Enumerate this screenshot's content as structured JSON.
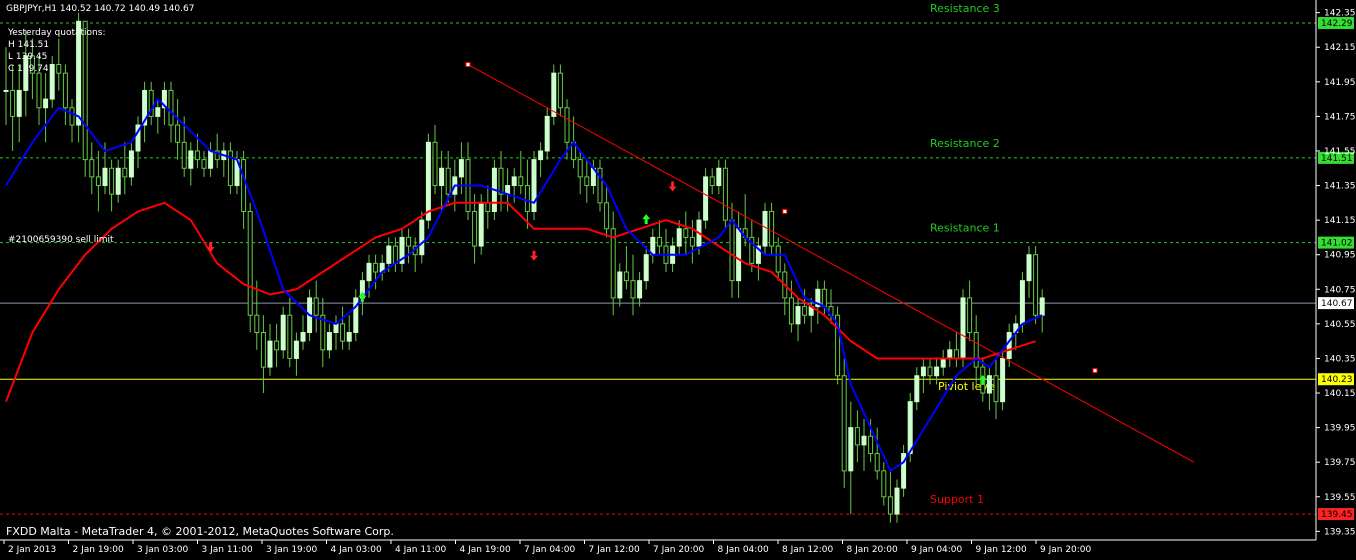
{
  "window": {
    "header": "GBPJPYr,H1  140.52 140.72 140.49 140.67",
    "footer": "FXDD Malta - MetaTrader 4, © 2001-2012, MetaQuotes Software Corp."
  },
  "quotes": {
    "title": "Yesterday quotations:",
    "high": "H 141.51",
    "low": "L 139.45",
    "close": "C 139.74"
  },
  "order": {
    "label": "#2100659390 sell limit"
  },
  "colors": {
    "background": "#000000",
    "bull": "#ccffcc",
    "bear": "#66cc44",
    "fast_ma": "#0000ff",
    "slow_ma": "#ff0000",
    "trendline": "#ff0000",
    "resistance": "#22cc22",
    "pivot": "#ffff00",
    "support": "#ff0000"
  },
  "chart_data": {
    "type": "candlestick",
    "symbol": "GBPJPYr",
    "timeframe": "H1",
    "ylim": [
      139.3,
      142.4
    ],
    "price_ticks": [
      "142.35",
      "142.15",
      "141.95",
      "141.75",
      "141.55",
      "141.35",
      "141.15",
      "140.95",
      "140.75",
      "140.55",
      "140.35",
      "140.15",
      "139.95",
      "139.75",
      "139.55",
      "139.35"
    ],
    "time_labels": [
      "2 Jan 2013",
      "2 Jan 19:00",
      "3 Jan 03:00",
      "3 Jan 11:00",
      "3 Jan 19:00",
      "4 Jan 03:00",
      "4 Jan 11:00",
      "4 Jan 19:00",
      "7 Jan 04:00",
      "7 Jan 12:00",
      "7 Jan 20:00",
      "8 Jan 04:00",
      "8 Jan 12:00",
      "8 Jan 20:00",
      "9 Jan 04:00",
      "9 Jan 12:00",
      "9 Jan 20:00"
    ],
    "levels": [
      {
        "name": "Resistance 3",
        "price": 142.29,
        "label": "142.29",
        "style": "resistance"
      },
      {
        "name": "Resistance 2",
        "price": 141.51,
        "label": "141.51",
        "style": "resistance"
      },
      {
        "name": "Resistance 1",
        "price": 141.02,
        "label": "141.02",
        "style": "resistance"
      },
      {
        "name": "Piviot level",
        "price": 140.23,
        "label": "140.23",
        "style": "pivot"
      },
      {
        "name": "Support 1",
        "price": 139.45,
        "label": "139.45",
        "style": "support"
      }
    ],
    "current_price": {
      "value": 140.67,
      "label": "140.67"
    },
    "ohlc": [
      [
        141.9,
        142.15,
        141.7,
        141.9
      ],
      [
        141.9,
        142.05,
        141.55,
        141.75
      ],
      [
        141.75,
        142.05,
        141.6,
        141.9
      ],
      [
        141.9,
        142.25,
        141.75,
        142.1
      ],
      [
        142.1,
        142.2,
        141.85,
        142.0
      ],
      [
        142.0,
        142.1,
        141.7,
        141.8
      ],
      [
        141.8,
        142.0,
        141.6,
        141.85
      ],
      [
        141.85,
        142.1,
        141.8,
        142.05
      ],
      [
        142.05,
        142.2,
        141.9,
        142.0
      ],
      [
        142.0,
        142.05,
        141.7,
        141.8
      ],
      [
        141.8,
        141.85,
        141.6,
        141.7
      ],
      [
        141.7,
        142.35,
        141.6,
        142.3
      ],
      [
        142.3,
        142.3,
        141.4,
        141.5
      ],
      [
        141.5,
        141.6,
        141.3,
        141.4
      ],
      [
        141.4,
        141.55,
        141.2,
        141.35
      ],
      [
        141.35,
        141.6,
        141.3,
        141.45
      ],
      [
        141.45,
        141.5,
        141.2,
        141.3
      ],
      [
        141.3,
        141.5,
        141.25,
        141.45
      ],
      [
        141.45,
        141.6,
        141.3,
        141.4
      ],
      [
        141.4,
        141.6,
        141.35,
        141.55
      ],
      [
        141.55,
        141.75,
        141.45,
        141.7
      ],
      [
        141.7,
        141.95,
        141.6,
        141.9
      ],
      [
        141.9,
        141.95,
        141.7,
        141.75
      ],
      [
        141.75,
        141.85,
        141.65,
        141.8
      ],
      [
        141.8,
        141.95,
        141.7,
        141.9
      ],
      [
        141.9,
        141.95,
        141.6,
        141.7
      ],
      [
        141.7,
        141.85,
        141.5,
        141.6
      ],
      [
        141.6,
        141.75,
        141.4,
        141.45
      ],
      [
        141.45,
        141.6,
        141.35,
        141.55
      ],
      [
        141.55,
        141.65,
        141.45,
        141.5
      ],
      [
        141.5,
        141.55,
        141.4,
        141.45
      ],
      [
        141.45,
        141.6,
        141.4,
        141.55
      ],
      [
        141.55,
        141.65,
        141.45,
        141.5
      ],
      [
        141.5,
        141.6,
        141.4,
        141.55
      ],
      [
        141.55,
        141.6,
        141.3,
        141.35
      ],
      [
        141.35,
        141.55,
        141.3,
        141.5
      ],
      [
        141.5,
        141.55,
        141.1,
        141.2
      ],
      [
        141.2,
        141.25,
        140.5,
        140.6
      ],
      [
        140.6,
        140.8,
        140.4,
        140.5
      ],
      [
        140.5,
        140.6,
        140.15,
        140.3
      ],
      [
        140.3,
        140.55,
        140.25,
        140.45
      ],
      [
        140.45,
        140.55,
        140.3,
        140.4
      ],
      [
        140.4,
        140.65,
        140.35,
        140.6
      ],
      [
        140.6,
        140.7,
        140.3,
        140.35
      ],
      [
        140.35,
        140.5,
        140.25,
        140.45
      ],
      [
        140.45,
        140.6,
        140.4,
        140.5
      ],
      [
        140.5,
        140.75,
        140.45,
        140.7
      ],
      [
        140.7,
        140.8,
        140.5,
        140.6
      ],
      [
        140.6,
        140.7,
        140.3,
        140.4
      ],
      [
        140.4,
        140.55,
        140.35,
        140.5
      ],
      [
        140.5,
        140.6,
        140.4,
        140.55
      ],
      [
        140.55,
        140.65,
        140.4,
        140.45
      ],
      [
        140.45,
        140.6,
        140.4,
        140.5
      ],
      [
        140.5,
        140.75,
        140.45,
        140.7
      ],
      [
        140.7,
        140.85,
        140.6,
        140.8
      ],
      [
        140.8,
        140.95,
        140.7,
        140.9
      ],
      [
        140.9,
        140.95,
        140.75,
        140.85
      ],
      [
        140.85,
        140.95,
        140.8,
        140.9
      ],
      [
        140.9,
        141.05,
        140.85,
        141.0
      ],
      [
        141.0,
        141.05,
        140.85,
        140.9
      ],
      [
        140.9,
        141.1,
        140.85,
        141.05
      ],
      [
        141.05,
        141.1,
        140.9,
        141.0
      ],
      [
        141.0,
        141.05,
        140.85,
        140.95
      ],
      [
        140.95,
        141.2,
        140.9,
        141.15
      ],
      [
        141.15,
        141.65,
        141.1,
        141.6
      ],
      [
        141.6,
        141.7,
        141.3,
        141.35
      ],
      [
        141.35,
        141.55,
        141.2,
        141.45
      ],
      [
        141.45,
        141.55,
        141.25,
        141.3
      ],
      [
        141.3,
        141.5,
        141.2,
        141.4
      ],
      [
        141.4,
        141.6,
        141.3,
        141.5
      ],
      [
        141.5,
        141.6,
        141.15,
        141.2
      ],
      [
        141.2,
        141.3,
        140.9,
        141.0
      ],
      [
        141.0,
        141.3,
        140.95,
        141.25
      ],
      [
        141.25,
        141.35,
        141.1,
        141.2
      ],
      [
        141.2,
        141.5,
        141.15,
        141.45
      ],
      [
        141.45,
        141.55,
        141.2,
        141.3
      ],
      [
        141.3,
        141.45,
        141.2,
        141.35
      ],
      [
        141.35,
        141.45,
        141.25,
        141.4
      ],
      [
        141.4,
        141.55,
        141.3,
        141.35
      ],
      [
        141.35,
        141.5,
        141.1,
        141.2
      ],
      [
        141.2,
        141.55,
        141.15,
        141.5
      ],
      [
        141.5,
        141.6,
        141.4,
        141.55
      ],
      [
        141.55,
        141.8,
        141.5,
        141.75
      ],
      [
        141.75,
        142.05,
        141.7,
        142.0
      ],
      [
        142.0,
        142.05,
        141.75,
        141.8
      ],
      [
        141.8,
        141.85,
        141.5,
        141.6
      ],
      [
        141.6,
        141.75,
        141.45,
        141.5
      ],
      [
        141.5,
        141.55,
        141.3,
        141.4
      ],
      [
        141.4,
        141.5,
        141.25,
        141.35
      ],
      [
        141.35,
        141.5,
        141.3,
        141.45
      ],
      [
        141.45,
        141.5,
        141.2,
        141.25
      ],
      [
        141.25,
        141.35,
        141.05,
        141.1
      ],
      [
        141.1,
        141.2,
        140.6,
        140.7
      ],
      [
        140.7,
        140.9,
        140.65,
        140.85
      ],
      [
        140.85,
        141.0,
        140.75,
        140.8
      ],
      [
        140.8,
        140.95,
        140.6,
        140.7
      ],
      [
        140.7,
        140.85,
        140.65,
        140.8
      ],
      [
        140.8,
        141.0,
        140.75,
        140.95
      ],
      [
        140.95,
        141.1,
        140.9,
        141.05
      ],
      [
        141.05,
        141.15,
        140.95,
        141.0
      ],
      [
        141.0,
        141.1,
        140.85,
        140.9
      ],
      [
        140.9,
        141.05,
        140.85,
        141.0
      ],
      [
        141.0,
        141.15,
        140.95,
        141.1
      ],
      [
        141.1,
        141.2,
        140.95,
        141.05
      ],
      [
        141.05,
        141.15,
        140.9,
        141.0
      ],
      [
        141.0,
        141.2,
        140.95,
        141.15
      ],
      [
        141.15,
        141.45,
        141.1,
        141.4
      ],
      [
        141.4,
        141.45,
        141.3,
        141.35
      ],
      [
        141.35,
        141.5,
        141.3,
        141.45
      ],
      [
        141.45,
        141.5,
        141.1,
        141.15
      ],
      [
        141.15,
        141.25,
        140.7,
        140.8
      ],
      [
        140.8,
        141.2,
        140.7,
        141.1
      ],
      [
        141.1,
        141.3,
        141.0,
        141.05
      ],
      [
        141.05,
        141.15,
        140.85,
        140.9
      ],
      [
        140.9,
        141.05,
        140.8,
        141.0
      ],
      [
        141.0,
        141.25,
        140.95,
        141.2
      ],
      [
        141.2,
        141.25,
        140.95,
        141.0
      ],
      [
        141.0,
        141.05,
        140.8,
        140.85
      ],
      [
        140.85,
        140.9,
        140.6,
        140.7
      ],
      [
        140.7,
        140.8,
        140.5,
        140.55
      ],
      [
        140.55,
        140.7,
        140.45,
        140.65
      ],
      [
        140.65,
        140.75,
        140.55,
        140.6
      ],
      [
        140.6,
        140.7,
        140.5,
        140.65
      ],
      [
        140.65,
        140.8,
        140.55,
        140.75
      ],
      [
        140.75,
        140.8,
        140.6,
        140.65
      ],
      [
        140.65,
        140.75,
        140.55,
        140.6
      ],
      [
        140.6,
        140.65,
        140.2,
        140.25
      ],
      [
        140.25,
        140.35,
        139.6,
        139.7
      ],
      [
        139.7,
        140.1,
        139.45,
        139.95
      ],
      [
        139.95,
        140.05,
        139.75,
        139.85
      ],
      [
        139.85,
        140.0,
        139.7,
        139.9
      ],
      [
        139.9,
        140.0,
        139.75,
        139.8
      ],
      [
        139.8,
        139.95,
        139.65,
        139.7
      ],
      [
        139.7,
        139.75,
        139.5,
        139.55
      ],
      [
        139.55,
        139.7,
        139.4,
        139.45
      ],
      [
        139.45,
        139.65,
        139.4,
        139.6
      ],
      [
        139.6,
        139.85,
        139.55,
        139.8
      ],
      [
        139.8,
        140.15,
        139.75,
        140.1
      ],
      [
        140.1,
        140.3,
        140.05,
        140.25
      ],
      [
        140.25,
        140.35,
        140.15,
        140.3
      ],
      [
        140.3,
        140.35,
        140.2,
        140.25
      ],
      [
        140.25,
        140.35,
        140.2,
        140.3
      ],
      [
        140.3,
        140.4,
        140.25,
        140.35
      ],
      [
        140.35,
        140.45,
        140.3,
        140.4
      ],
      [
        140.4,
        140.5,
        140.3,
        140.35
      ],
      [
        140.35,
        140.75,
        140.3,
        140.7
      ],
      [
        140.7,
        140.8,
        140.45,
        140.5
      ],
      [
        140.5,
        140.6,
        140.2,
        140.3
      ],
      [
        140.3,
        140.35,
        140.1,
        140.15
      ],
      [
        140.15,
        140.3,
        140.05,
        140.25
      ],
      [
        140.25,
        140.35,
        140.0,
        140.1
      ],
      [
        140.1,
        140.4,
        140.05,
        140.35
      ],
      [
        140.35,
        140.55,
        140.3,
        140.5
      ],
      [
        140.5,
        140.6,
        140.4,
        140.55
      ],
      [
        140.55,
        140.85,
        140.5,
        140.8
      ],
      [
        140.8,
        141.0,
        140.7,
        140.95
      ],
      [
        140.95,
        141.0,
        140.55,
        140.6
      ],
      [
        140.6,
        140.75,
        140.5,
        140.7
      ]
    ],
    "fast_ma": [
      [
        0,
        141.35
      ],
      [
        4,
        141.6
      ],
      [
        8,
        141.8
      ],
      [
        11,
        141.75
      ],
      [
        15,
        141.55
      ],
      [
        19,
        141.6
      ],
      [
        23,
        141.85
      ],
      [
        27,
        141.7
      ],
      [
        31,
        141.55
      ],
      [
        35,
        141.5
      ],
      [
        38,
        141.2
      ],
      [
        42,
        140.75
      ],
      [
        46,
        140.6
      ],
      [
        50,
        140.55
      ],
      [
        53,
        140.65
      ],
      [
        57,
        140.85
      ],
      [
        61,
        140.95
      ],
      [
        64,
        141.05
      ],
      [
        68,
        141.35
      ],
      [
        72,
        141.35
      ],
      [
        76,
        141.3
      ],
      [
        80,
        141.25
      ],
      [
        84,
        141.5
      ],
      [
        86,
        141.6
      ],
      [
        88,
        141.5
      ],
      [
        91,
        141.35
      ],
      [
        94,
        141.1
      ],
      [
        98,
        140.95
      ],
      [
        103,
        140.95
      ],
      [
        108,
        141.05
      ],
      [
        110,
        141.15
      ],
      [
        112,
        141.05
      ],
      [
        115,
        140.95
      ],
      [
        118,
        140.95
      ],
      [
        121,
        140.7
      ],
      [
        124,
        140.65
      ],
      [
        126,
        140.55
      ],
      [
        128,
        140.2
      ],
      [
        131,
        139.95
      ],
      [
        134,
        139.7
      ],
      [
        136,
        139.75
      ],
      [
        140,
        140.0
      ],
      [
        144,
        140.25
      ],
      [
        147,
        140.35
      ],
      [
        149,
        140.3
      ],
      [
        152,
        140.45
      ],
      [
        154,
        140.55
      ],
      [
        157,
        140.6
      ]
    ],
    "slow_ma": [
      [
        0,
        140.1
      ],
      [
        4,
        140.5
      ],
      [
        8,
        140.75
      ],
      [
        12,
        140.95
      ],
      [
        16,
        141.1
      ],
      [
        20,
        141.2
      ],
      [
        24,
        141.25
      ],
      [
        28,
        141.15
      ],
      [
        32,
        140.9
      ],
      [
        36,
        140.78
      ],
      [
        40,
        140.72
      ],
      [
        44,
        140.75
      ],
      [
        48,
        140.85
      ],
      [
        52,
        140.95
      ],
      [
        56,
        141.05
      ],
      [
        60,
        141.1
      ],
      [
        64,
        141.2
      ],
      [
        68,
        141.25
      ],
      [
        72,
        141.25
      ],
      [
        76,
        141.25
      ],
      [
        80,
        141.1
      ],
      [
        84,
        141.1
      ],
      [
        88,
        141.1
      ],
      [
        92,
        141.05
      ],
      [
        96,
        141.1
      ],
      [
        100,
        141.15
      ],
      [
        104,
        141.1
      ],
      [
        108,
        141.0
      ],
      [
        112,
        140.9
      ],
      [
        116,
        140.85
      ],
      [
        120,
        140.7
      ],
      [
        124,
        140.6
      ],
      [
        128,
        140.45
      ],
      [
        132,
        140.35
      ],
      [
        136,
        140.35
      ],
      [
        140,
        140.35
      ],
      [
        144,
        140.35
      ],
      [
        148,
        140.35
      ],
      [
        152,
        140.4
      ],
      [
        156,
        140.45
      ]
    ],
    "trendline": {
      "from": [
        70,
        142.05
      ],
      "to": [
        180,
        139.75
      ],
      "markers": [
        [
          70,
          142.05
        ],
        [
          118,
          141.2
        ],
        [
          165,
          140.28
        ]
      ]
    },
    "arrows": [
      {
        "i": 31,
        "price": 141.0,
        "dir": "down"
      },
      {
        "i": 54,
        "price": 140.7,
        "dir": "up"
      },
      {
        "i": 80,
        "price": 140.95,
        "dir": "down"
      },
      {
        "i": 97,
        "price": 141.15,
        "dir": "up"
      },
      {
        "i": 101,
        "price": 141.35,
        "dir": "down"
      },
      {
        "i": 148,
        "price": 140.22,
        "dir": "up"
      }
    ]
  }
}
